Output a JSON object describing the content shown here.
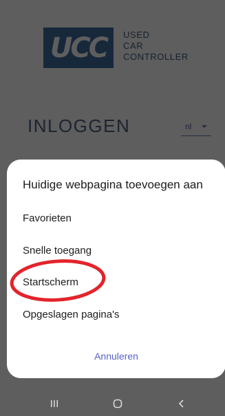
{
  "logo": {
    "mark": "UCC",
    "line1": "USED",
    "line2": "CAR",
    "line3": "CONTROLLER"
  },
  "login": {
    "title": "INLOGGEN",
    "language": "nl"
  },
  "sheet": {
    "title": "Huidige webpagina toevoegen aan",
    "items": [
      {
        "label": "Favorieten"
      },
      {
        "label": "Snelle toegang"
      },
      {
        "label": "Startscherm"
      },
      {
        "label": "Opgeslagen pagina's"
      }
    ],
    "cancel_label": "Annuleren"
  },
  "annotation": {
    "color": "#e3242b"
  },
  "navbar": {
    "icons": [
      "recent-apps-icon",
      "home-icon",
      "back-icon"
    ]
  }
}
